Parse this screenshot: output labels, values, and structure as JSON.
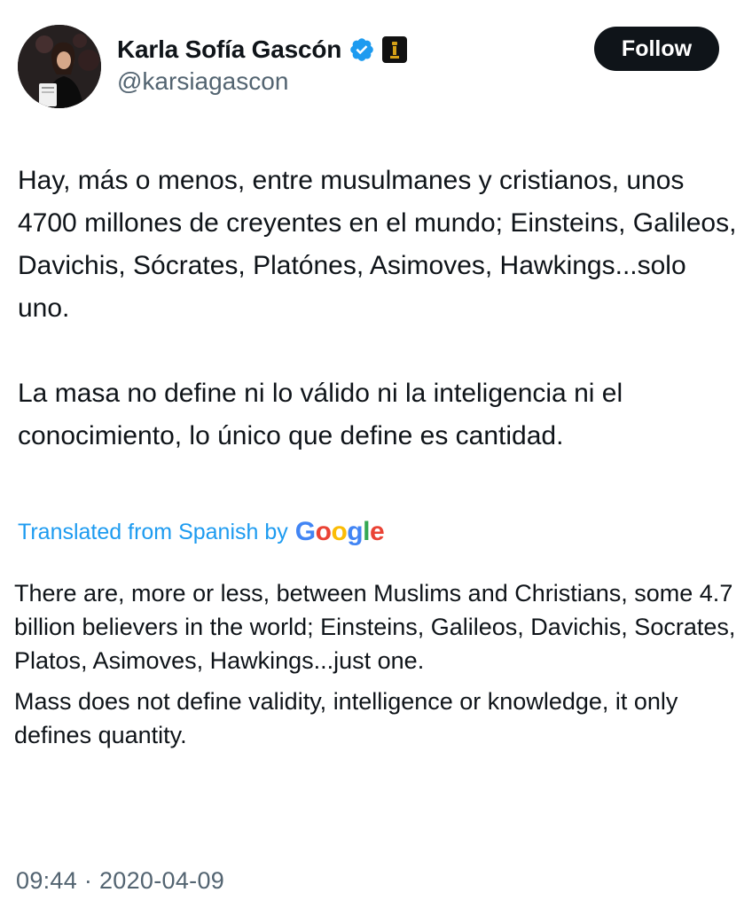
{
  "author": {
    "display_name": "Karla Sofía Gascón",
    "handle": "@karsiagascon",
    "verified": true,
    "avatar_icon": "profile-photo"
  },
  "follow_button": {
    "label": "Follow"
  },
  "tweet": {
    "paragraphs": [
      "Hay, más o menos, entre musulmanes y cristianos, unos 4700 millones de creyentes en el mundo; Einsteins, Galileos, Davichis, Sócrates, Platónes, Asimoves, Hawkings...solo uno.",
      "La masa no define ni lo válido ni la inteligencia ni el conocimiento, lo único que define es cantidad."
    ]
  },
  "translation": {
    "attribution": "Translated from Spanish by",
    "provider": "Google",
    "paragraphs": [
      "There are, more or less, between Muslims and Christians, some 4.7 billion believers in the world; Einsteins, Galileos, Davichis, Socrates, Platos, Asimoves, Hawkings...just one.",
      "Mass does not define validity, intelligence or knowledge, it only defines quantity."
    ]
  },
  "meta": {
    "timestamp": "09:44 · 2020-04-09"
  },
  "colors": {
    "link_blue": "#1d9bf0",
    "secondary_text": "#536471",
    "primary_text": "#0f1419",
    "verified_blue": "#1d9bf0"
  }
}
